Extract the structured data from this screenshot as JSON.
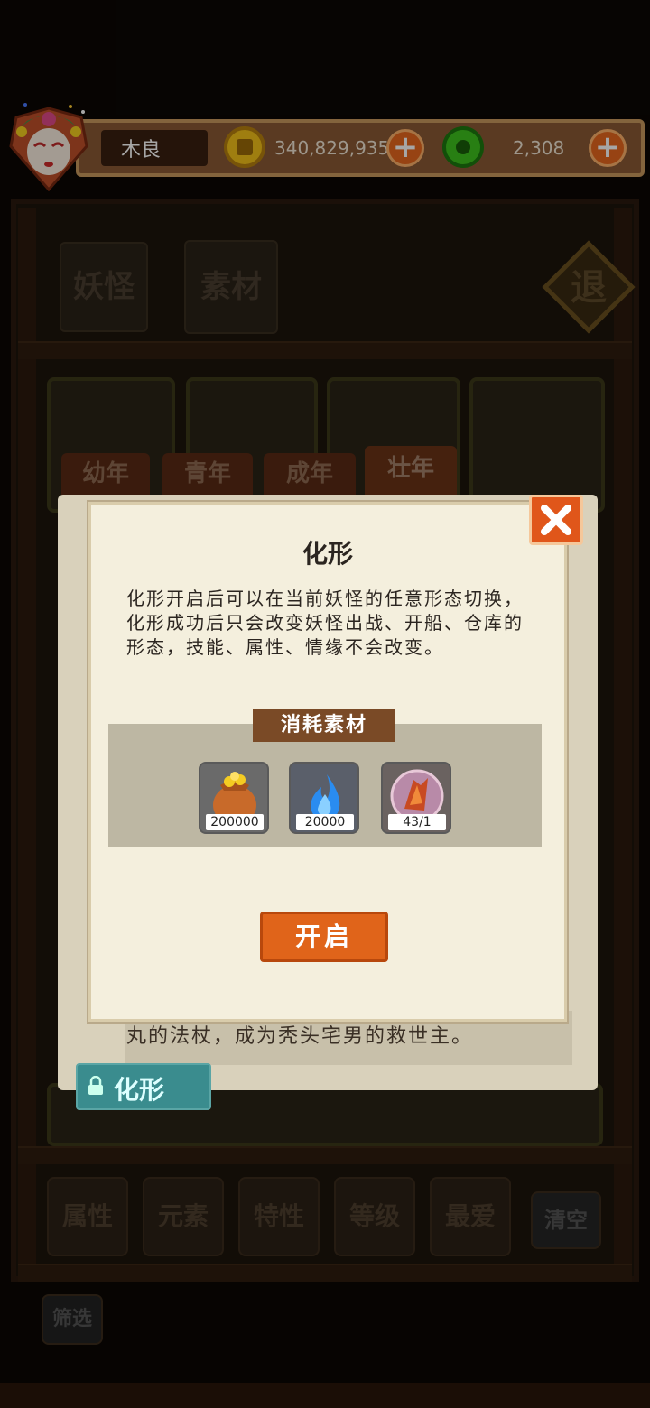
{
  "header": {
    "player_name": "木良",
    "gold": "340,829,935",
    "jade": "2,308"
  },
  "exit_label": "退",
  "category_tabs": [
    "妖怪",
    "素材"
  ],
  "age_tabs": [
    "幼年",
    "青年",
    "成年",
    "壮年"
  ],
  "bottom_filters": [
    "属性",
    "元素",
    "特性",
    "等级",
    "最爱",
    "清空"
  ],
  "filter_label": "筛选",
  "background_panel": {
    "description": "丸的法杖，成为秃头宅男的救世主。",
    "huaxing_tab": "化形"
  },
  "dialog": {
    "title": "化形",
    "description": "化形开启后可以在当前妖怪的任意形态切换，化形成功后只会改变妖怪出战、开船、仓库的形态，技能、属性、情缘不会改变。",
    "materials_header": "消耗素材",
    "materials": [
      {
        "icon": "gold-bag-icon",
        "count": "200000"
      },
      {
        "icon": "blue-flame-icon",
        "count": "20000"
      },
      {
        "icon": "crystal-orb-icon",
        "count": "43/1"
      }
    ],
    "confirm_label": "开启"
  },
  "colors": {
    "accent_orange": "#e0641a",
    "dialog_bg": "#f4efdd",
    "header_brown": "#8a5a35"
  }
}
